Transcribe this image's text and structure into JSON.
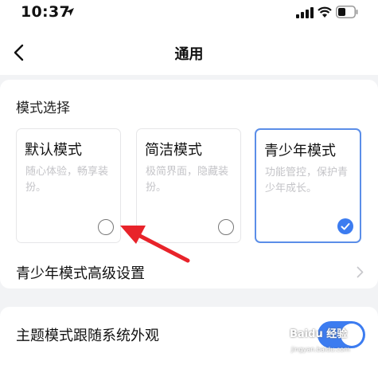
{
  "status_bar": {
    "time": "10:37"
  },
  "nav": {
    "title": "通用"
  },
  "mode_section": {
    "title": "模式选择",
    "modes": [
      {
        "name": "默认模式",
        "desc": "随心体验，畅享装扮。",
        "selected": false
      },
      {
        "name": "简洁模式",
        "desc": "极简界面，隐藏装扮。",
        "selected": false
      },
      {
        "name": "青少年模式",
        "desc": "功能管控，保护青少年成长。",
        "selected": true
      }
    ]
  },
  "advanced": {
    "label": "青少年模式高级设置"
  },
  "theme": {
    "label": "主题模式跟随系统外观",
    "toggle_on": true
  },
  "watermark": {
    "text": "Baidu 经验",
    "url": "jingyan.baidu.com"
  },
  "colors": {
    "accent": "#3c7cf0",
    "annotation": "#e8232a"
  }
}
